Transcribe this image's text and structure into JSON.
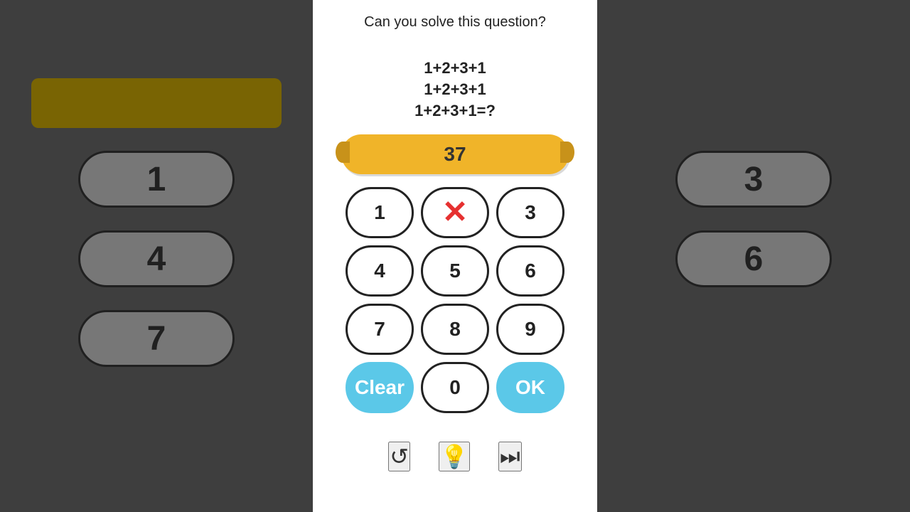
{
  "title": "Can you solve this question?",
  "equations": [
    "1+2+3+1",
    "1+2+3+1",
    "1+2+3+1=?"
  ],
  "answer": "37",
  "numpad": {
    "rows": [
      [
        {
          "label": "1",
          "type": "number"
        },
        {
          "label": "×",
          "type": "delete"
        },
        {
          "label": "3",
          "type": "number"
        }
      ],
      [
        {
          "label": "4",
          "type": "number"
        },
        {
          "label": "5",
          "type": "number"
        },
        {
          "label": "6",
          "type": "number"
        }
      ],
      [
        {
          "label": "7",
          "type": "number"
        },
        {
          "label": "8",
          "type": "number"
        },
        {
          "label": "9",
          "type": "number"
        }
      ],
      [
        {
          "label": "Clear",
          "type": "action"
        },
        {
          "label": "0",
          "type": "number"
        },
        {
          "label": "OK",
          "type": "action"
        }
      ]
    ]
  },
  "toolbar": {
    "retry_icon": "↺",
    "hint_icon": "💡",
    "skip_icon": "⏭"
  },
  "bg_left_buttons": [
    "1",
    "4",
    "7"
  ],
  "bg_right_buttons": [
    "3",
    "6"
  ]
}
